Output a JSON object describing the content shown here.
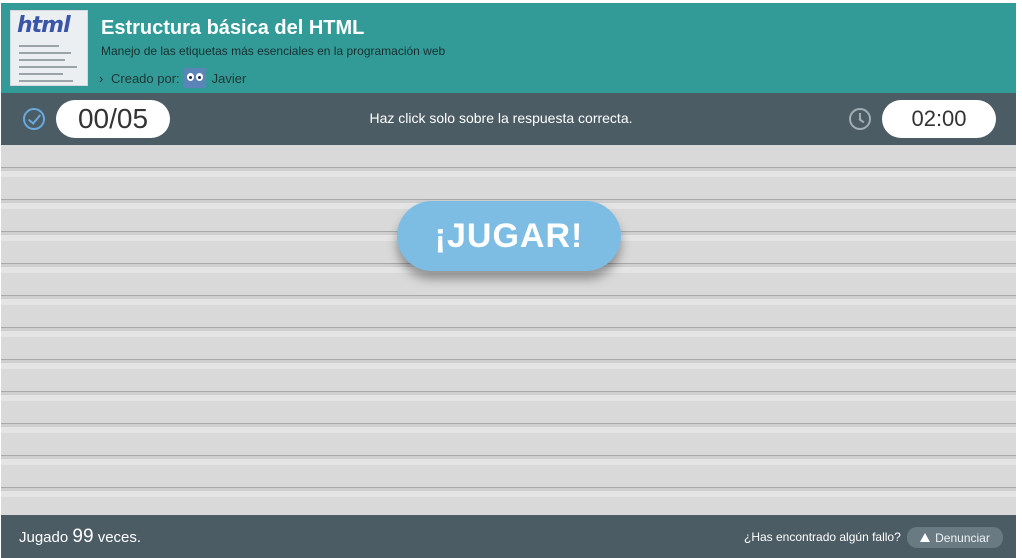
{
  "header": {
    "thumbnail_word": "html",
    "title": "Estructura básica del HTML",
    "subtitle": "Manejo de las etiquetas más esenciales en la programación web",
    "created_by_label": "Creado por:",
    "creator_name": "Javier"
  },
  "toolbar": {
    "score": "00/05",
    "instruction": "Haz click solo sobre la respuesta correcta.",
    "timer": "02:00"
  },
  "game": {
    "play_label": "¡JUGAR!"
  },
  "footer": {
    "played_prefix": "Jugado",
    "played_count": "99",
    "played_suffix": "veces.",
    "fault_question": "¿Has encontrado algún fallo?",
    "report_label": "Denunciar"
  },
  "colors": {
    "header_bg": "#329b98",
    "bar_bg": "#4c5c64",
    "play_button": "#7dbde4",
    "check_icon": "#69a9e0"
  },
  "icons": [
    "check-circle-icon",
    "clock-icon",
    "chevron-right-icon",
    "warning-icon"
  ]
}
